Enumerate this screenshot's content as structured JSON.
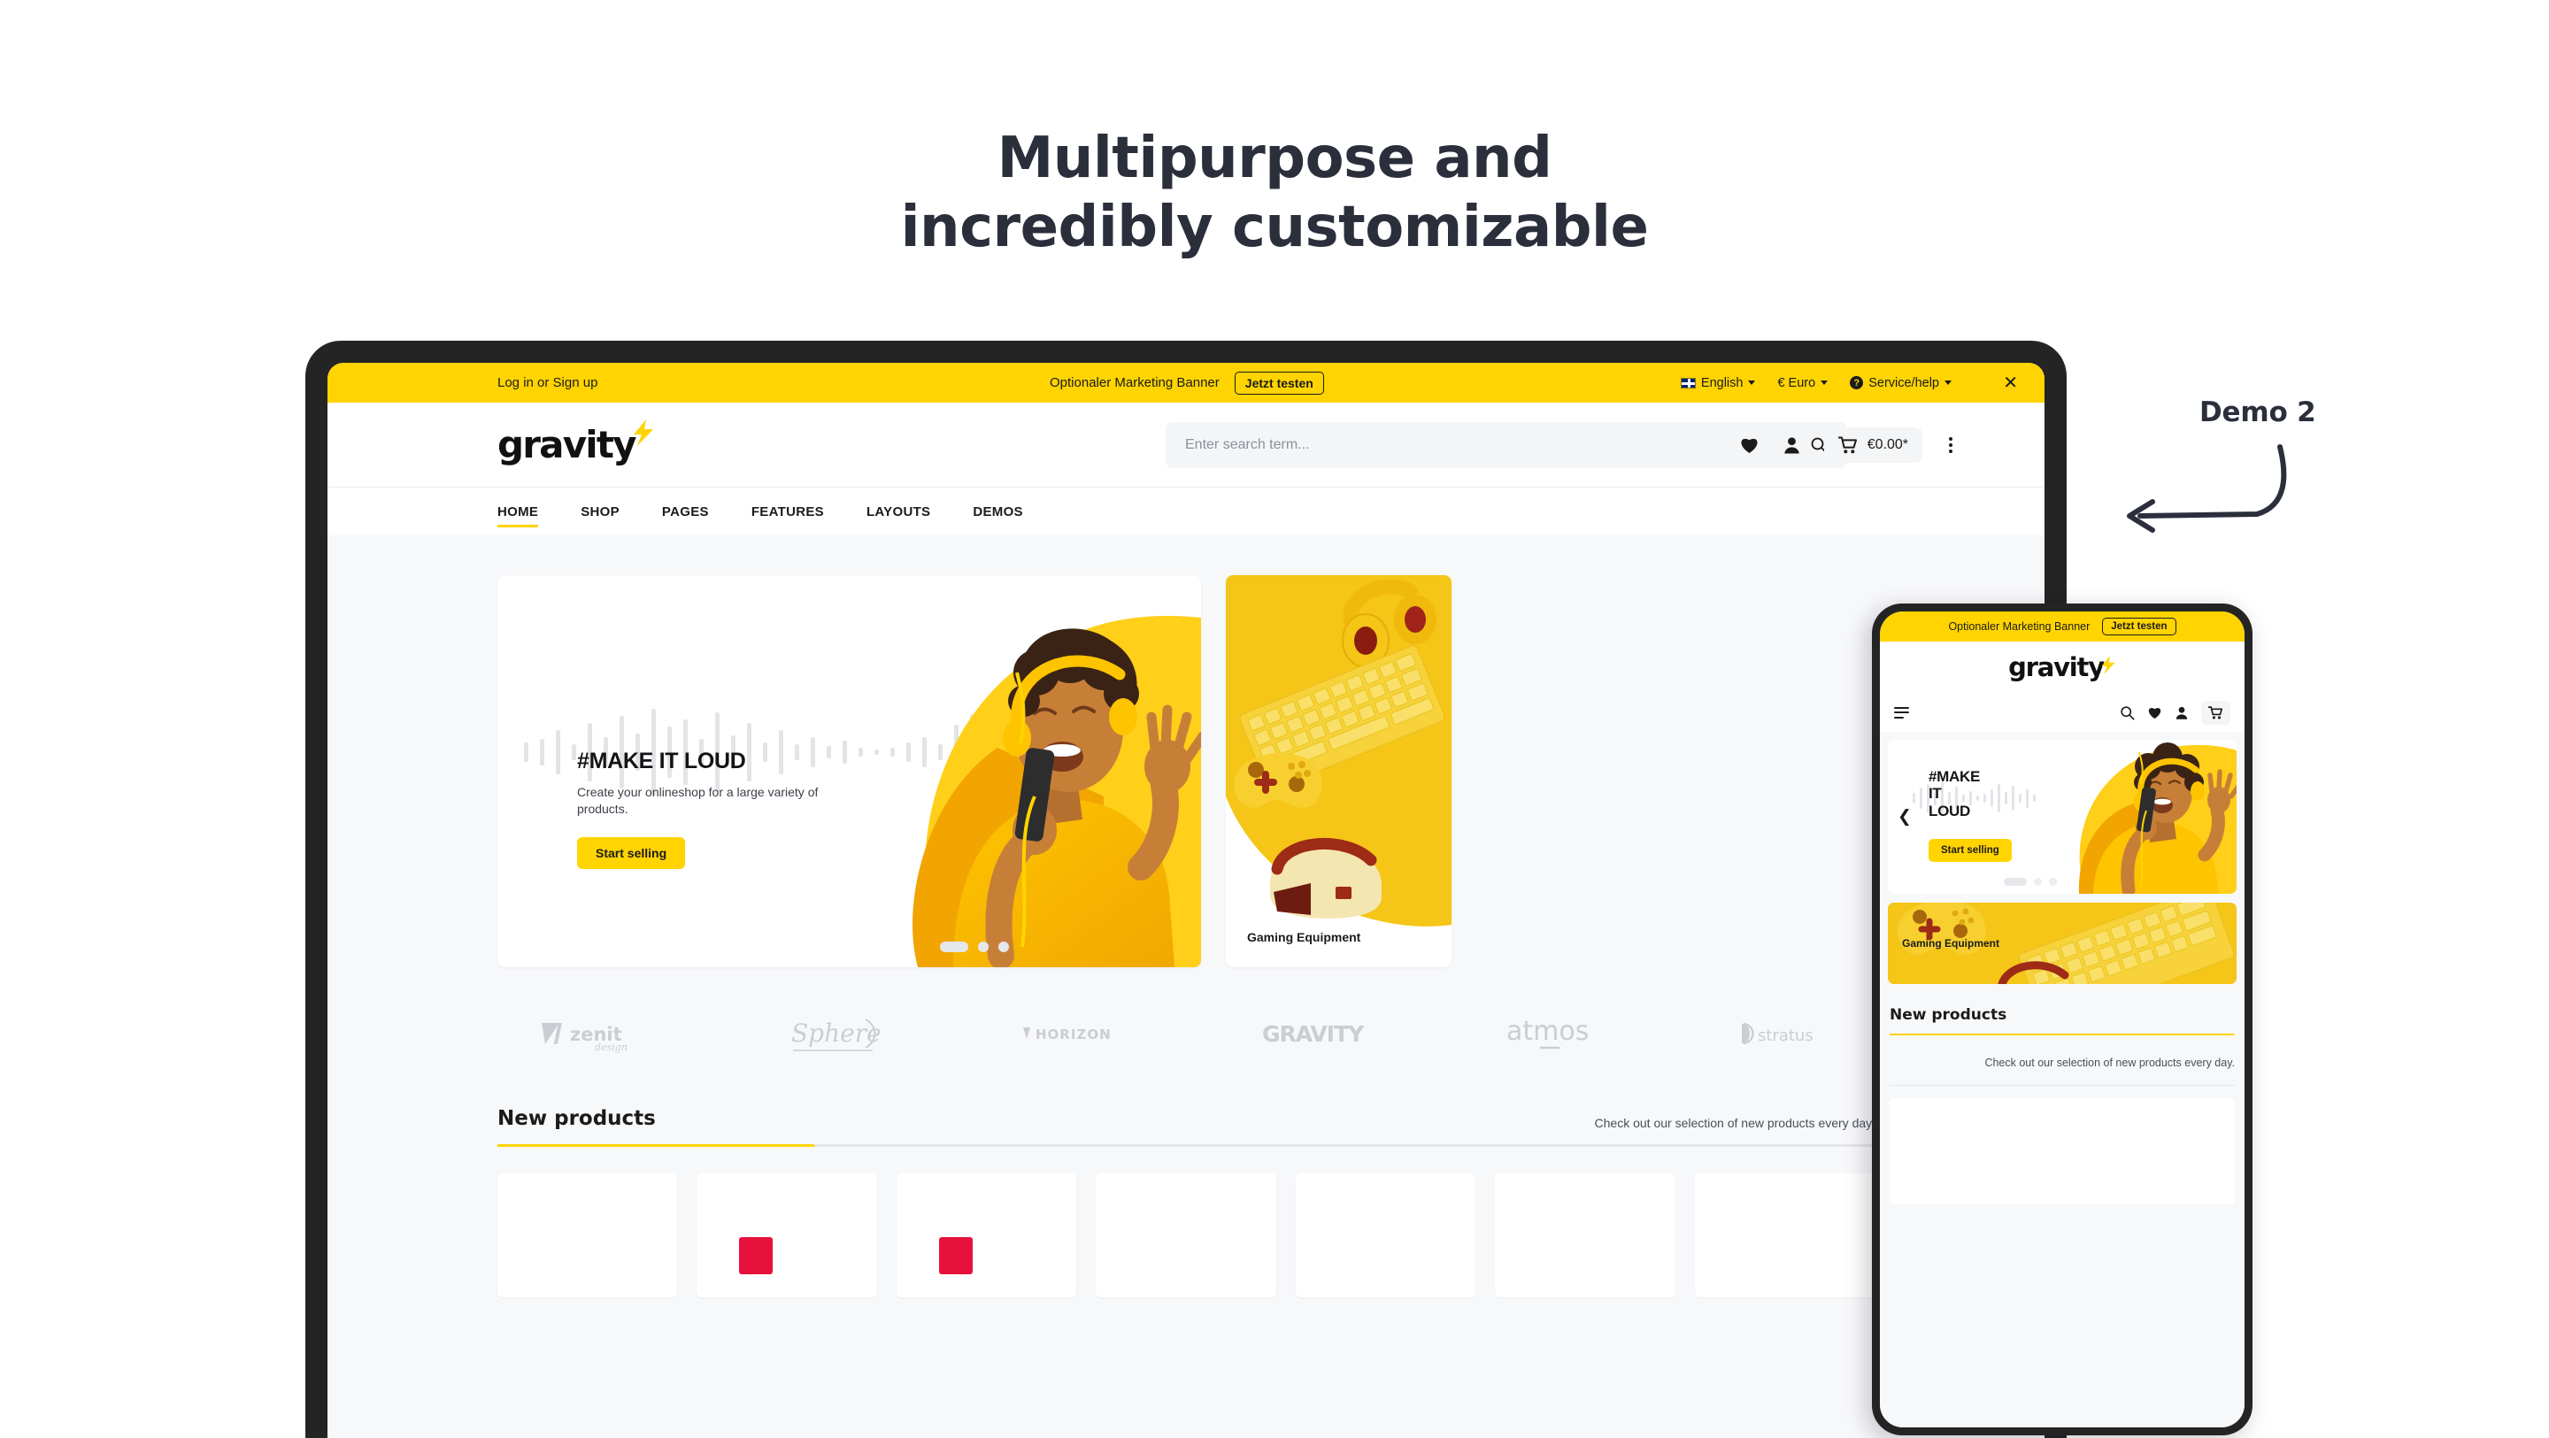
{
  "headline": {
    "line1": "Multipurpose and",
    "line2": "incredibly customizable"
  },
  "annotation": {
    "label": "Demo 2",
    "arrow_icon": "curved-arrow-left-icon"
  },
  "colors": {
    "brand_yellow": "#ffd400",
    "dark": "#2b2f3c",
    "page_bg": "#f7f8fa",
    "accent_red": "#e8113c"
  },
  "desktop": {
    "topbar": {
      "login_text": "Log in or Sign up",
      "marketing_text": "Optionaler Marketing Banner",
      "cta_label": "Jetzt testen",
      "language": "English",
      "currency": "€ Euro",
      "service": "Service/help",
      "close_icon": "close-icon",
      "flag_icon": "uk-flag-icon",
      "help_icon": "help-circle-icon"
    },
    "header": {
      "logo_text": "gravity",
      "logo_icon": "lightning-bolt-icon",
      "search_placeholder": "Enter search term...",
      "search_value": "",
      "search_icon": "search-icon",
      "wishlist_icon": "heart-icon",
      "account_icon": "user-icon",
      "cart_icon": "cart-icon",
      "cart_total": "€0.00*",
      "menu_icon": "kebab-menu-icon"
    },
    "nav": {
      "items": [
        {
          "label": "HOME",
          "active": true
        },
        {
          "label": "SHOP",
          "active": false
        },
        {
          "label": "PAGES",
          "active": false
        },
        {
          "label": "FEATURES",
          "active": false
        },
        {
          "label": "LAYOUTS",
          "active": false
        },
        {
          "label": "DEMOS",
          "active": false
        }
      ]
    },
    "hero": {
      "title": "#MAKE IT LOUD",
      "subtitle": "Create your onlineshop for a large variety of products.",
      "cta_label": "Start selling",
      "slides_total": 3,
      "slide_active": 1
    },
    "category_card": {
      "label": "Gaming Equipment"
    },
    "brands": [
      {
        "name": "zenit design"
      },
      {
        "name": "Sphere"
      },
      {
        "name": "HORIZON"
      },
      {
        "name": "GRAVITY"
      },
      {
        "name": "atmos"
      },
      {
        "name": "stratus"
      }
    ],
    "new_products": {
      "title": "New products",
      "description": "Check out our selection of new products every day.",
      "cards": [
        {
          "badge": false
        },
        {
          "badge": true
        },
        {
          "badge": true
        },
        {
          "badge": false
        },
        {
          "badge": false
        },
        {
          "badge": false
        },
        {
          "badge": false
        }
      ]
    }
  },
  "mobile": {
    "topbar": {
      "marketing_text": "Optionaler Marketing Banner",
      "cta_label": "Jetzt testen"
    },
    "header": {
      "logo_text": "gravity",
      "logo_icon": "lightning-bolt-icon",
      "menu_icon": "hamburger-menu-icon",
      "search_icon": "search-icon",
      "wishlist_icon": "heart-icon",
      "account_icon": "user-icon",
      "cart_icon": "cart-icon"
    },
    "hero": {
      "title_line1": "#MAKE",
      "title_line2": "IT",
      "title_line3": "LOUD",
      "cta_label": "Start selling",
      "prev_icon": "chevron-left-icon",
      "slides_total": 3,
      "slide_active": 1
    },
    "category_card": {
      "label": "Gaming Equipment"
    },
    "new_products": {
      "title": "New products",
      "description": "Check out our selection of new products every day."
    }
  }
}
